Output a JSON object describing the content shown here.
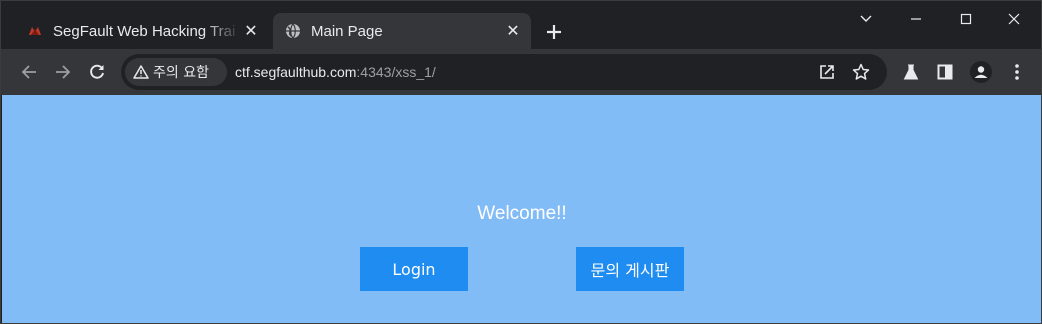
{
  "tabs": [
    {
      "title": "SegFault Web Hacking Trai",
      "active": false,
      "favicon": "segfault-logo-icon"
    },
    {
      "title": "Main Page",
      "active": true,
      "favicon": "globe-icon"
    }
  ],
  "omnibox": {
    "security_label": "주의 요함",
    "url_host": "ctf.segfaulthub.com",
    "url_rest": ":4343/xss_1/"
  },
  "page": {
    "welcome": "Welcome!!",
    "login_label": "Login",
    "board_label": "문의 게시판"
  },
  "colors": {
    "page_bg": "#82bcf6",
    "button_bg": "#1e8cf0",
    "chrome_dark": "#202124",
    "toolbar": "#35363a"
  }
}
